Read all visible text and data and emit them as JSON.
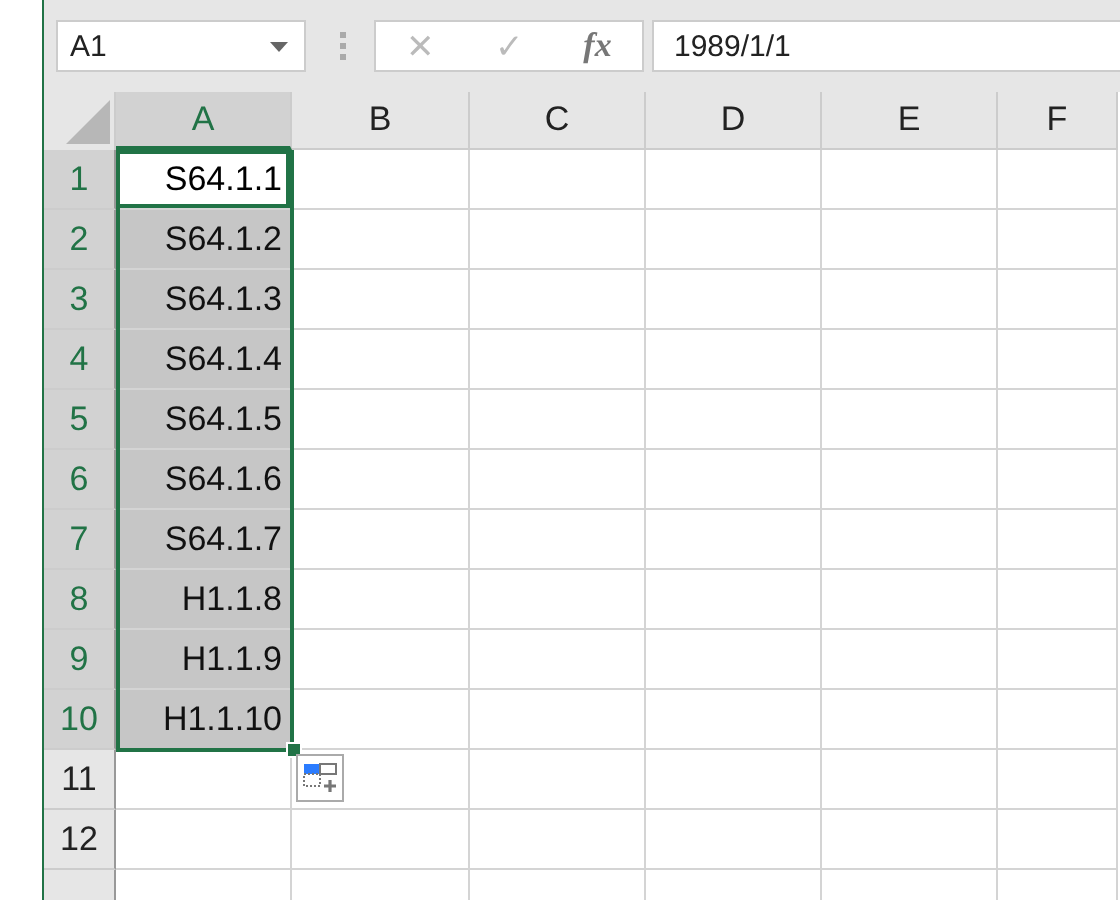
{
  "name_box": {
    "value": "A1"
  },
  "formula_bar": {
    "cancel": "✕",
    "enter": "✓",
    "function": "fx",
    "value": "1989/1/1"
  },
  "columns": [
    {
      "label": "A",
      "selected": true
    },
    {
      "label": "B",
      "selected": false
    },
    {
      "label": "C",
      "selected": false
    },
    {
      "label": "D",
      "selected": false
    },
    {
      "label": "E",
      "selected": false
    },
    {
      "label": "F",
      "selected": false
    }
  ],
  "rows": [
    {
      "number": "1",
      "selected": true,
      "active": true,
      "a": "S64.1.1"
    },
    {
      "number": "2",
      "selected": true,
      "active": false,
      "a": "S64.1.2"
    },
    {
      "number": "3",
      "selected": true,
      "active": false,
      "a": "S64.1.3"
    },
    {
      "number": "4",
      "selected": true,
      "active": false,
      "a": "S64.1.4"
    },
    {
      "number": "5",
      "selected": true,
      "active": false,
      "a": "S64.1.5"
    },
    {
      "number": "6",
      "selected": true,
      "active": false,
      "a": "S64.1.6"
    },
    {
      "number": "7",
      "selected": true,
      "active": false,
      "a": "S64.1.7"
    },
    {
      "number": "8",
      "selected": true,
      "active": false,
      "a": "H1.1.8"
    },
    {
      "number": "9",
      "selected": true,
      "active": false,
      "a": "H1.1.9"
    },
    {
      "number": "10",
      "selected": true,
      "active": false,
      "a": "H1.1.10"
    },
    {
      "number": "11",
      "selected": false,
      "active": false
    },
    {
      "number": "12",
      "selected": false,
      "active": false
    }
  ]
}
